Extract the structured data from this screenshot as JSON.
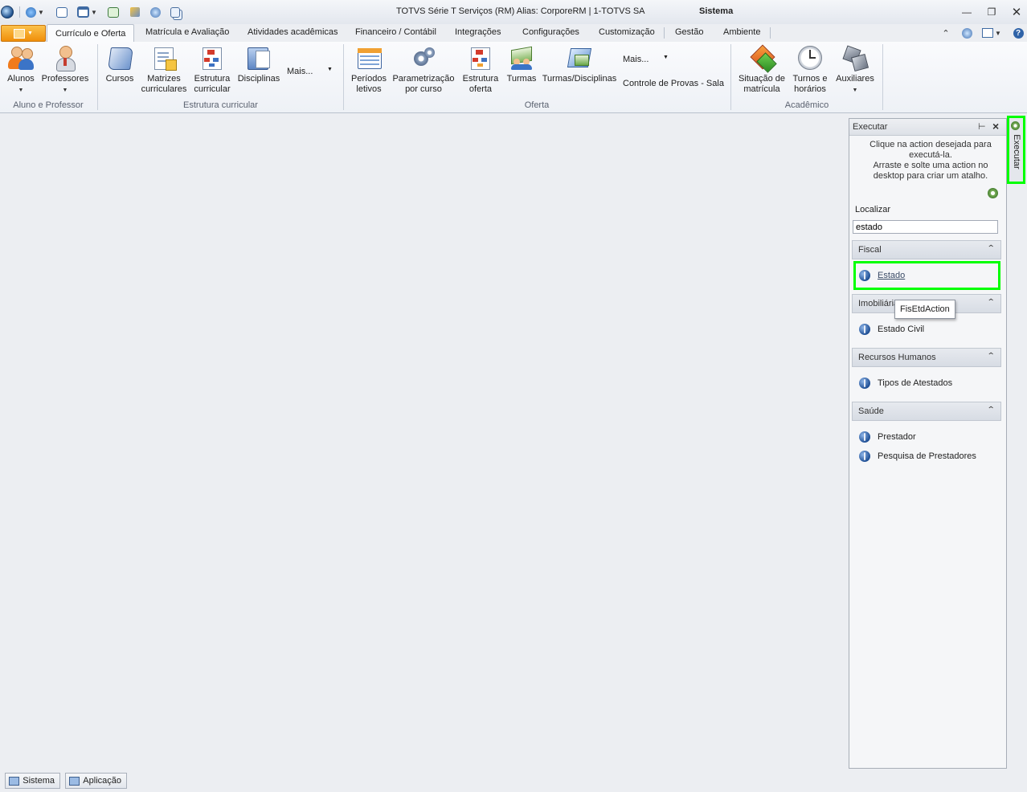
{
  "window": {
    "title": "TOTVS Série T Serviços (RM) Alias: CorporeRM | 1-TOTVS SA",
    "app_name": "Sistema"
  },
  "tabs": [
    {
      "label": "Currículo e Oferta",
      "active": true
    },
    {
      "label": "Matrícula e Avaliação"
    },
    {
      "label": "Atividades acadêmicas"
    },
    {
      "label": "Financeiro / Contábil"
    },
    {
      "label": "Integrações"
    },
    {
      "label": "Configurações"
    },
    {
      "label": "Customização"
    },
    {
      "label": "Gestão"
    },
    {
      "label": "Ambiente"
    }
  ],
  "ribbon": {
    "groups": {
      "aluno_professor": "Aluno e Professor",
      "estrutura": "Estrutura curricular",
      "oferta": "Oferta",
      "academico": "Acadêmico"
    },
    "buttons": {
      "alunos": "Alunos",
      "professores": "Professores",
      "cursos": "Cursos",
      "matrizes_1": "Matrizes",
      "matrizes_2": "curriculares",
      "estrutura_1": "Estrutura",
      "estrutura_2": "curricular",
      "disciplinas": "Disciplinas",
      "mais_1": "Mais...",
      "periodos_1": "Períodos",
      "periodos_2": "letivos",
      "param_1": "Parametrização",
      "param_2": "por curso",
      "estr_oferta_1": "Estrutura",
      "estr_oferta_2": "oferta",
      "turmas": "Turmas",
      "turmas_disc": "Turmas/Disciplinas",
      "mais_2": "Mais...",
      "controle_provas": "Controle de Provas - Sala",
      "situacao_1": "Situação de",
      "situacao_2": "matrícula",
      "turnos_1": "Turnos e",
      "turnos_2": "horários",
      "auxiliares": "Auxiliares"
    }
  },
  "panel": {
    "title": "Executar",
    "hint_1": "Clique na action desejada para executá-la.",
    "hint_2": "Arraste e solte uma action no desktop para criar um atalho.",
    "search_label": "Localizar",
    "search_value": "estado",
    "sections": [
      {
        "title": "Fiscal",
        "items": [
          "Estado"
        ]
      },
      {
        "title": "Imobiliária",
        "items": [
          "Estado Civil"
        ]
      },
      {
        "title": "Recursos Humanos",
        "items": [
          "Tipos de Atestados"
        ]
      },
      {
        "title": "Saúde",
        "items": [
          "Prestador",
          "Pesquisa de Prestadores"
        ]
      }
    ],
    "tooltip": "FisEtdAction"
  },
  "side_tab": "Executar",
  "status": {
    "sistema": "Sistema",
    "aplicacao": "Aplicação"
  },
  "colors": {
    "highlight": "#00ff00",
    "app_menu": "#f5a623"
  }
}
